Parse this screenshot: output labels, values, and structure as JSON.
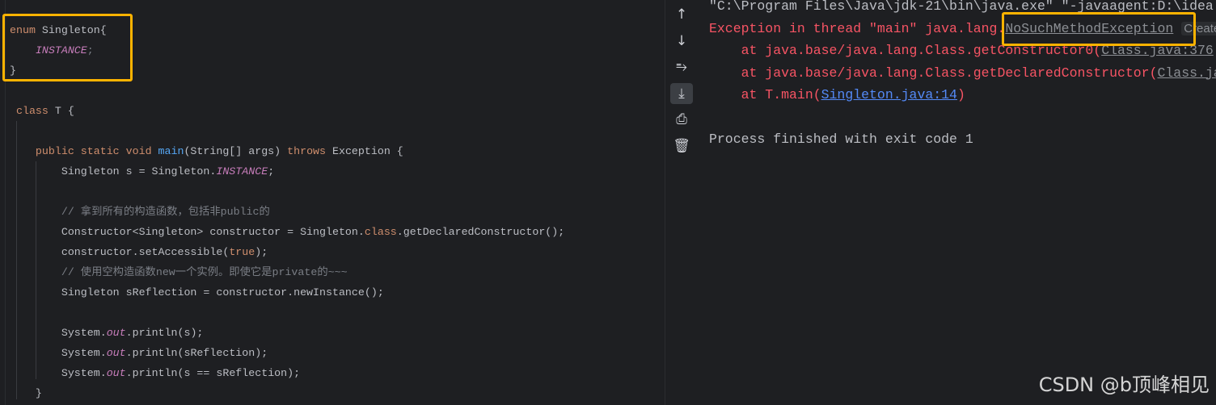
{
  "editor": {
    "lines": [
      {
        "tokens": [
          {
            "t": "enum ",
            "c": "kw"
          },
          {
            "t": "Singleton{",
            "c": "plain"
          }
        ]
      },
      {
        "tokens": [
          {
            "t": "    ",
            "c": "plain"
          },
          {
            "t": "INSTANCE",
            "c": "const"
          },
          {
            "t": ";",
            "c": "cm"
          }
        ]
      },
      {
        "tokens": [
          {
            "t": "}",
            "c": "plain"
          }
        ]
      },
      {
        "tokens": []
      },
      {
        "tokens": [
          {
            "t": " class ",
            "c": "kw"
          },
          {
            "t": "T {",
            "c": "plain"
          }
        ]
      },
      {
        "tokens": []
      },
      {
        "tokens": [
          {
            "t": "    public static void ",
            "c": "kw"
          },
          {
            "t": "main",
            "c": "fn"
          },
          {
            "t": "(String[] args) ",
            "c": "plain"
          },
          {
            "t": "throws ",
            "c": "kw"
          },
          {
            "t": "Exception {",
            "c": "plain"
          }
        ]
      },
      {
        "tokens": [
          {
            "t": "        Singleton s = Singleton.",
            "c": "plain"
          },
          {
            "t": "INSTANCE",
            "c": "const"
          },
          {
            "t": ";",
            "c": "plain"
          }
        ]
      },
      {
        "tokens": []
      },
      {
        "tokens": [
          {
            "t": "        // 拿到所有的构造函数，包括非public的",
            "c": "cm"
          }
        ]
      },
      {
        "tokens": [
          {
            "t": "        Constructor<Singleton> constructor = Singleton.",
            "c": "plain"
          },
          {
            "t": "class",
            "c": "kw"
          },
          {
            "t": ".getDeclaredConstructor();",
            "c": "plain"
          }
        ]
      },
      {
        "tokens": [
          {
            "t": "        constructor.setAccessible(",
            "c": "plain"
          },
          {
            "t": "true",
            "c": "kw"
          },
          {
            "t": ");",
            "c": "plain"
          }
        ]
      },
      {
        "tokens": [
          {
            "t": "        // 使用空构造函数new一个实例。即使它是private的~~~",
            "c": "cm"
          }
        ]
      },
      {
        "tokens": [
          {
            "t": "        Singleton sReflection = constructor.newInstance();",
            "c": "plain"
          }
        ]
      },
      {
        "tokens": []
      },
      {
        "tokens": [
          {
            "t": "        System.",
            "c": "plain"
          },
          {
            "t": "out",
            "c": "const"
          },
          {
            "t": ".println(s);",
            "c": "plain"
          }
        ]
      },
      {
        "tokens": [
          {
            "t": "        System.",
            "c": "plain"
          },
          {
            "t": "out",
            "c": "const"
          },
          {
            "t": ".println(sReflection);",
            "c": "plain"
          }
        ]
      },
      {
        "tokens": [
          {
            "t": "        System.",
            "c": "plain"
          },
          {
            "t": "out",
            "c": "const"
          },
          {
            "t": ".println(s == sReflection);",
            "c": "plain"
          }
        ]
      },
      {
        "tokens": [
          {
            "t": "    }",
            "c": "plain"
          }
        ]
      }
    ]
  },
  "toolbar": {
    "items": [
      {
        "name": "up-arrow-icon",
        "glyph": "↑"
      },
      {
        "name": "down-arrow-icon",
        "glyph": "↓"
      },
      {
        "name": "soft-wrap-icon",
        "glyph": "⥱"
      },
      {
        "name": "scroll-to-end-icon",
        "glyph": "⤓"
      },
      {
        "name": "print-icon",
        "glyph": "⎙"
      },
      {
        "name": "trash-icon",
        "glyph": "🗑"
      }
    ]
  },
  "console": {
    "lines": [
      {
        "tokens": [
          {
            "t": "\"C:\\Program Files\\Java\\jdk-21\\bin\\java.exe\" \"-javaagent:D:\\idea",
            "c": "norm"
          }
        ]
      },
      {
        "tokens": [
          {
            "t": "Exception in thread \"main\" java.lang.",
            "c": "err"
          },
          {
            "t": "NoSuchMethodException",
            "c": "glink"
          },
          {
            "t": " ",
            "c": "err"
          },
          {
            "t": "Create",
            "c": "create"
          }
        ]
      },
      {
        "tokens": [
          {
            "t": "    at java.base/java.lang.Class.getConstructor0(",
            "c": "err"
          },
          {
            "t": "Class.java:376",
            "c": "glink"
          }
        ]
      },
      {
        "tokens": [
          {
            "t": "    at java.base/java.lang.Class.getDeclaredConstructor(",
            "c": "err"
          },
          {
            "t": "Class.java",
            "c": "glink"
          }
        ]
      },
      {
        "tokens": [
          {
            "t": "    at T.main(",
            "c": "err"
          },
          {
            "t": "Singleton.java:14",
            "c": "link"
          },
          {
            "t": ")",
            "c": "err"
          }
        ]
      },
      {
        "tokens": []
      },
      {
        "tokens": [
          {
            "t": "Process finished with exit code 1",
            "c": "norm"
          }
        ]
      }
    ]
  },
  "watermark": "CSDN @b顶峰相见"
}
